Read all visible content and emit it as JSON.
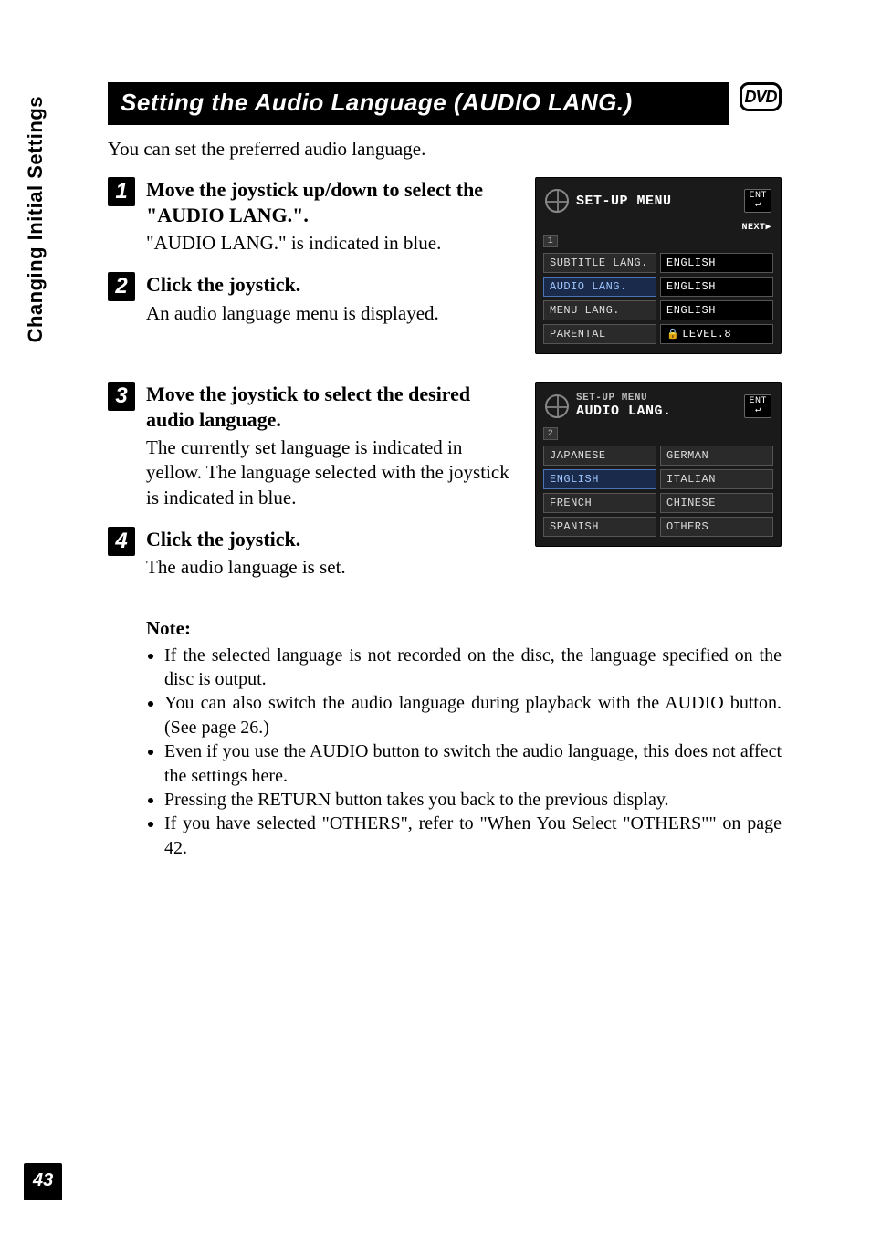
{
  "sideTab": "Changing Initial Settings",
  "pageNumber": "43",
  "title": "Setting the Audio Language (AUDIO LANG.)",
  "mediaBadge": "DVD",
  "intro": "You can set the preferred audio language.",
  "steps": {
    "s1": {
      "num": "1",
      "head": "Move the joystick up/down to select the \"AUDIO LANG.\".",
      "desc": "\"AUDIO LANG.\" is indicated in blue."
    },
    "s2": {
      "num": "2",
      "head": "Click the joystick.",
      "desc": "An audio language menu is displayed."
    },
    "s3": {
      "num": "3",
      "head": "Move the joystick to select the desired audio language.",
      "desc": "The currently set language is indicated in yellow. The language selected with the joystick is indicated in blue."
    },
    "s4": {
      "num": "4",
      "head": "Click the joystick.",
      "desc": "The audio language is set."
    }
  },
  "screen1": {
    "title": "SET-UP MENU",
    "ent": "ENT",
    "next": "NEXT▶",
    "tab": "1",
    "rows": [
      {
        "label": "SUBTITLE LANG.",
        "value": "ENGLISH",
        "highlight": false
      },
      {
        "label": "AUDIO LANG.",
        "value": "ENGLISH",
        "highlight": true
      },
      {
        "label": "MENU LANG.",
        "value": "ENGLISH",
        "highlight": false
      },
      {
        "label": "PARENTAL",
        "value": "LEVEL.8",
        "highlight": false,
        "lock": true
      }
    ]
  },
  "screen2": {
    "titleSmall": "SET-UP MENU",
    "title": "AUDIO LANG.",
    "ent": "ENT",
    "tab": "2",
    "options": [
      {
        "label": "JAPANESE",
        "highlight": false
      },
      {
        "label": "GERMAN",
        "highlight": false
      },
      {
        "label": "ENGLISH",
        "highlight": true
      },
      {
        "label": "ITALIAN",
        "highlight": false
      },
      {
        "label": "FRENCH",
        "highlight": false
      },
      {
        "label": "CHINESE",
        "highlight": false
      },
      {
        "label": "SPANISH",
        "highlight": false
      },
      {
        "label": "OTHERS",
        "highlight": false
      }
    ]
  },
  "notes": {
    "head": "Note:",
    "items": [
      "If the selected language is not recorded on the disc, the language specified on the disc is output.",
      "You can also switch the audio language during playback with the AUDIO button. (See page 26.)",
      "Even if you use the AUDIO button to switch the audio language, this does not affect the settings here.",
      "Pressing the RETURN button takes you back to the previous display.",
      "If you have selected \"OTHERS\", refer to \"When You Select \"OTHERS\"\" on page 42."
    ]
  }
}
